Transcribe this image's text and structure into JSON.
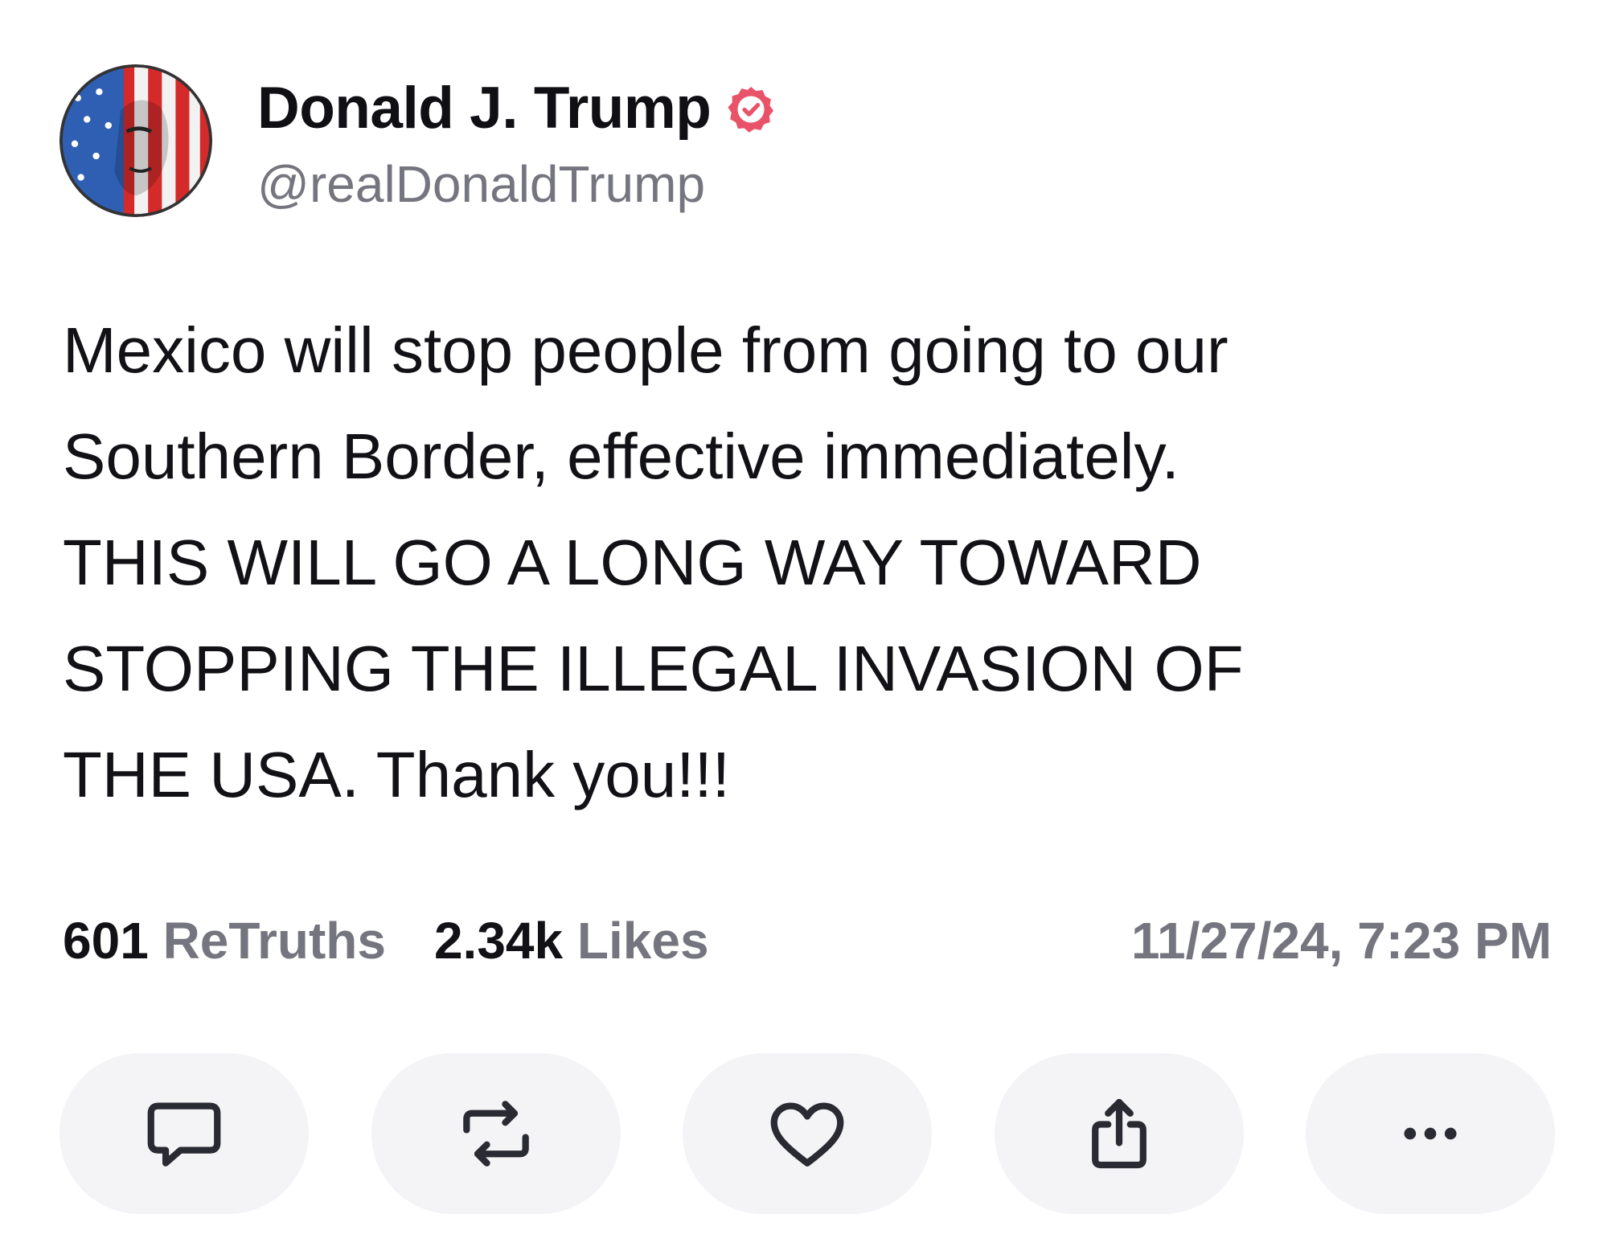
{
  "author": {
    "display_name": "Donald J. Trump",
    "handle": "@realDonaldTrump",
    "verified_icon": "verified-badge-icon",
    "verified_color": "#e8536a",
    "avatar_icon": "avatar-flag-portrait"
  },
  "post": {
    "lines": [
      "Mexico will stop people from going to our",
      "Southern Border, effective immediately.",
      "THIS WILL GO A LONG WAY TOWARD",
      "STOPPING THE ILLEGAL INVASION OF",
      "THE USA. Thank you!!!"
    ]
  },
  "stats": {
    "retruths_count": "601",
    "retruths_label": "ReTruths",
    "likes_count": "2.34k",
    "likes_label": "Likes",
    "timestamp": "11/27/24, 7:23 PM"
  },
  "actions": [
    {
      "name": "reply",
      "icon": "comment-icon"
    },
    {
      "name": "retruth",
      "icon": "repost-icon"
    },
    {
      "name": "like",
      "icon": "heart-icon"
    },
    {
      "name": "share",
      "icon": "share-icon"
    },
    {
      "name": "more",
      "icon": "more-icon"
    }
  ],
  "colors": {
    "text": "#111116",
    "muted": "#75757f",
    "action_bg": "#f4f4f7",
    "icon": "#2a2a33"
  }
}
